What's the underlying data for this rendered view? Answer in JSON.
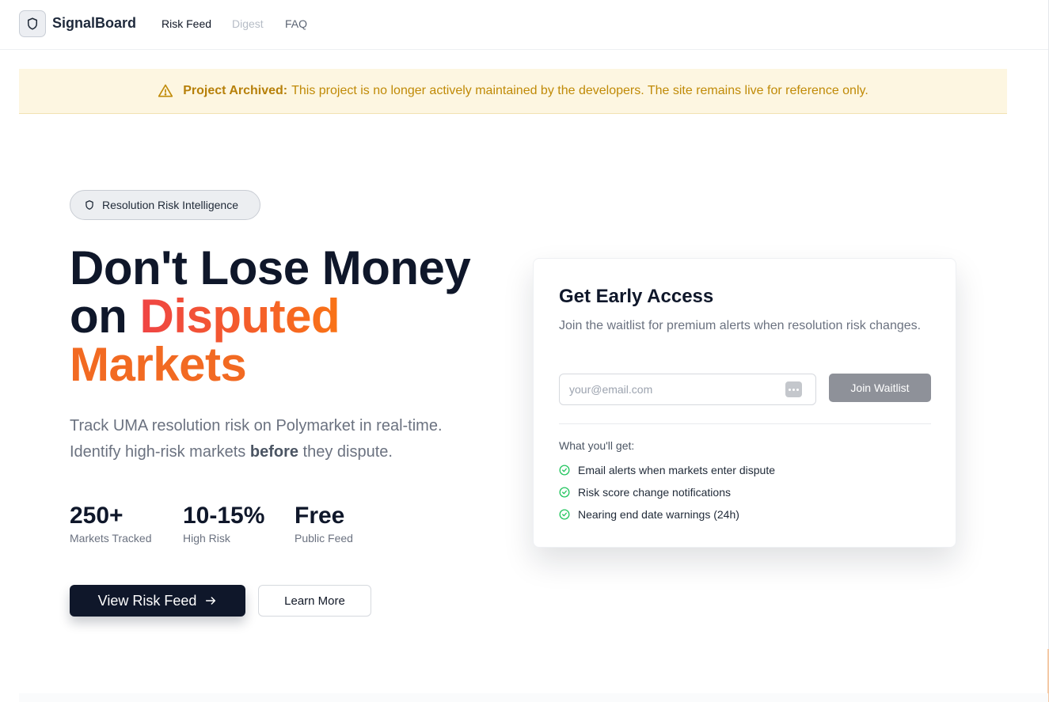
{
  "header": {
    "brand": "SignalBoard",
    "nav": [
      {
        "label": "Risk Feed"
      },
      {
        "label": "Digest"
      },
      {
        "label": "FAQ"
      }
    ]
  },
  "banner": {
    "title": "Project Archived:",
    "message": "This project is no longer actively maintained by the developers. The site remains live for reference only."
  },
  "hero": {
    "pill": "Resolution Risk Intelligence",
    "headline_line1": "Don't Lose Money",
    "headline_on": "on",
    "headline_highlight1": "Disputed",
    "headline_highlight2": "Markets",
    "sub_line1": "Track UMA resolution risk on Polymarket in real-time.",
    "sub_line2_pre": "Identify high-risk markets",
    "sub_line2_bold": "before",
    "sub_line2_post": "they dispute.",
    "stats": [
      {
        "value": "250+",
        "label": "Markets Tracked"
      },
      {
        "value": "10-15%",
        "label": "High Risk"
      },
      {
        "value": "Free",
        "label": "Public Feed"
      }
    ],
    "primary_button": "View Risk Feed",
    "secondary_button": "Learn More"
  },
  "card": {
    "title": "Get Early Access",
    "description": "Join the waitlist for premium alerts when resolution risk changes.",
    "email_placeholder": "your@email.com",
    "join_button": "Join Waitlist",
    "benefits_title": "What you'll get:",
    "benefits": [
      "Email alerts when markets enter dispute",
      "Risk score change notifications",
      "Nearing end date warnings (24h)"
    ]
  },
  "colors": {
    "accent_red": "#ef4444",
    "accent_orange": "#f97316",
    "banner_text": "#c08a07",
    "check_green": "#22c55e",
    "dark": "#0f172a"
  }
}
